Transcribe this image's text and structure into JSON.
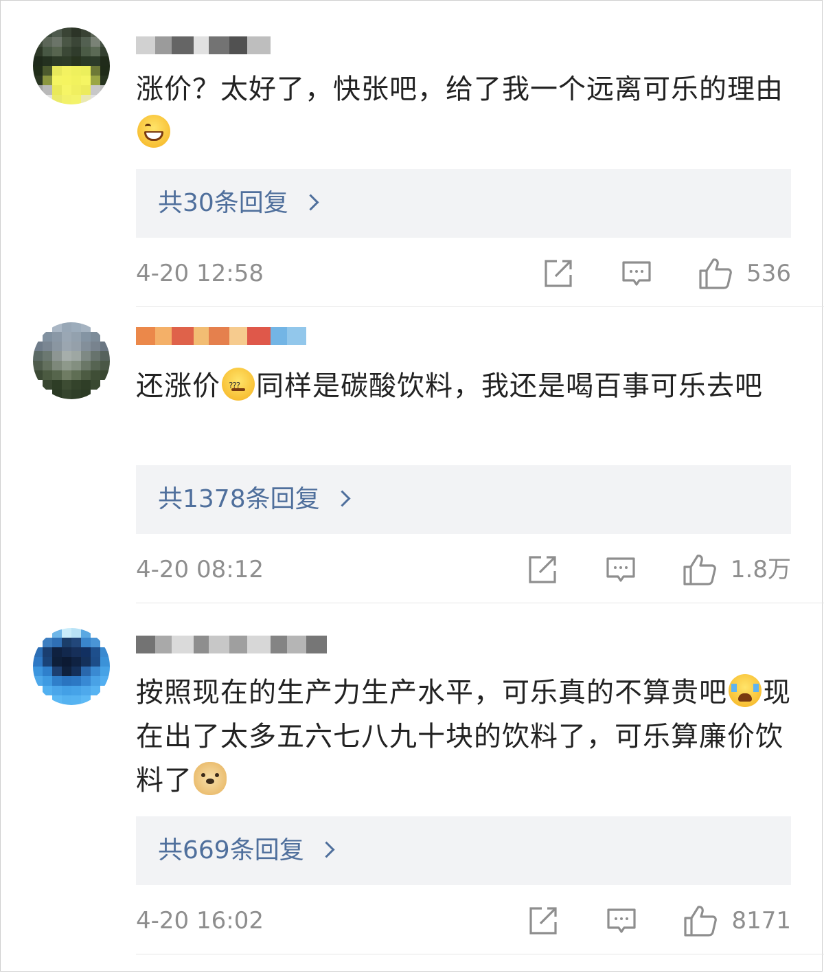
{
  "comments": [
    {
      "avatar_colors": [
        "#2f3327",
        "#3c4a3b",
        "#4e5a4d",
        "#3a4435",
        "#2c3427",
        "#394234",
        "#5a6355",
        "#343c30",
        "#3e4a3a",
        "#5c6658",
        "#6b7468",
        "#4a5645",
        "#3b4637",
        "#536051",
        "#7a8276",
        "#455043",
        "#2d3827",
        "#485844",
        "#57654f",
        "#3b4836",
        "#303c2c",
        "#4b5b46",
        "#5b6a55",
        "#344030",
        "#1f2a1b",
        "#243120",
        "#2c3a27",
        "#2e3c28",
        "#28341f",
        "#2b3a27",
        "#2c3b29",
        "#202b1a",
        "#202d19",
        "#4c5a2e",
        "#e7e85b",
        "#f3f261",
        "#eff05d",
        "#ecef5c",
        "#6d7937",
        "#1f2b18",
        "#2a3622",
        "#8c9740",
        "#f4f462",
        "#f5f460",
        "#f2f25e",
        "#f5f563",
        "#9aa645",
        "#27341f",
        "#a2a2a2",
        "#b9b9b9",
        "#e9e95a",
        "#f6f566",
        "#f0ef60",
        "#eceb5d",
        "#c8c8c8",
        "#bdbdbd",
        "#d9d9d9",
        "#e2e2e2",
        "#eaea6a",
        "#f2f16a",
        "#f3f36b",
        "#e9e8b2",
        "#e0e0e0",
        "#e9e9e9"
      ],
      "username_blocks": [
        "#c9c9c9",
        "#8a8a8a",
        "#4a4a4a",
        "#dcdcdc",
        "#5a5a5a",
        "#333333",
        "#b3b3b3"
      ],
      "text_parts": [
        "涨价？太好了，快张吧，给了我一个远离可乐的理由"
      ],
      "emoji": [
        "grin-emoji"
      ],
      "reply_label": "共30条回复",
      "time": "4-20 12:58",
      "likes": "536"
    },
    {
      "avatar_colors": [
        "#ffffff",
        "#ffffff",
        "#a9b6c4",
        "#98a7b6",
        "#9cacbb",
        "#a4b2c0",
        "#ffffff",
        "#ffffff",
        "#ffffff",
        "#8191a0",
        "#8a98a6",
        "#9aa7b4",
        "#93a1ae",
        "#8494a3",
        "#7d8c99",
        "#ffffff",
        "#6f7c8a",
        "#7a8692",
        "#8a96a1",
        "#9ba6b0",
        "#95a0aa",
        "#838f9a",
        "#78838e",
        "#6a7682",
        "#5c6a65",
        "#6b7871",
        "#8d9693",
        "#a6aeab",
        "#9ea7a3",
        "#7e8984",
        "#67736d",
        "#56625c",
        "#4f5c4c",
        "#63705e",
        "#7d887a",
        "#8e998b",
        "#838f80",
        "#6a7767",
        "#566452",
        "#4a5746",
        "#3c4a35",
        "#4b5a41",
        "#56654c",
        "#6f7c63",
        "#5f6e54",
        "#4c5b42",
        "#3f4e36",
        "#3a4832",
        "#ffffff",
        "#384630",
        "#2e3d26",
        "#3d4c33",
        "#34432b",
        "#2f3e27",
        "#394830",
        "#ffffff",
        "#ffffff",
        "#ffffff",
        "#2b3a24",
        "#35442d",
        "#2f3e28",
        "#2c3b25",
        "#ffffff",
        "#ffffff"
      ],
      "username_blocks": [
        "#e8732a",
        "#f2a24d",
        "#d9462a",
        "#f0b25a",
        "#e06a2e",
        "#f5c27a",
        "#d93b2a",
        "#5aa8e0",
        "#7fbde8"
      ],
      "text_parts": [
        "还涨价",
        "同样是碳酸饮料，我还是喝百事可乐去吧"
      ],
      "emoji": [
        "dizzy-emoji"
      ],
      "reply_label": "共1378条回复",
      "time": "4-20 08:12",
      "likes": "1.8万"
    },
    {
      "avatar_colors": [
        "#ffffff",
        "#ffffff",
        "#6fb6e8",
        "#c9ecfa",
        "#b8e2f6",
        "#5aa8e2",
        "#ffffff",
        "#ffffff",
        "#ffffff",
        "#3d7ec0",
        "#2f6fb5",
        "#1b3e6a",
        "#22477a",
        "#3a86cc",
        "#4a95d6",
        "#ffffff",
        "#2c6eb5",
        "#1a3e70",
        "#0f2140",
        "#12284d",
        "#162f59",
        "#123061",
        "#1e4f8c",
        "#3a8ad0",
        "#2e78c4",
        "#1a4378",
        "#0e1f3a",
        "#0c1a33",
        "#0f2242",
        "#14305a",
        "#1d4d89",
        "#3b92d8",
        "#3c95de",
        "#2f80cc",
        "#1d3f70",
        "#0f213d",
        "#14305a",
        "#2a68ad",
        "#3a8ad2",
        "#46a2e6",
        "#4ea8ea",
        "#3f9be2",
        "#2f7fca",
        "#2a74c0",
        "#2c78c4",
        "#3889d4",
        "#49a2e6",
        "#52aef0",
        "#ffffff",
        "#52b0f0",
        "#4aa6ea",
        "#43a0e6",
        "#46a3e8",
        "#4ea9ec",
        "#57b3f2",
        "#ffffff",
        "#ffffff",
        "#ffffff",
        "#5bb8f4",
        "#55b2f0",
        "#56b3f1",
        "#5db9f5",
        "#ffffff",
        "#ffffff"
      ],
      "username_blocks": [
        "#5a5a5a",
        "#9a9a9a",
        "#d4d4d4",
        "#7a7a7a",
        "#bdbdbd",
        "#8e8e8e",
        "#d0d0d0",
        "#6e6e6e",
        "#a8a8a8",
        "#5e5e5e"
      ],
      "text_parts": [
        "按照现在的生产力生产水平，可乐真的不算贵吧",
        "现在出了太多五六七八九十块的饮料了，可乐算廉价饮料了"
      ],
      "emoji": [
        "crying-laughing-emoji",
        "doge-emoji"
      ],
      "reply_label": "共669条回复",
      "time": "4-20 16:02",
      "likes": "8171"
    }
  ],
  "icons": {
    "share": "share-icon",
    "comment": "comment-icon",
    "like": "thumbs-up-icon"
  },
  "colors": {
    "link": "#4f6f9c",
    "muted": "#8e8e8e",
    "text": "#222222",
    "reply_bg": "#f2f3f5"
  }
}
